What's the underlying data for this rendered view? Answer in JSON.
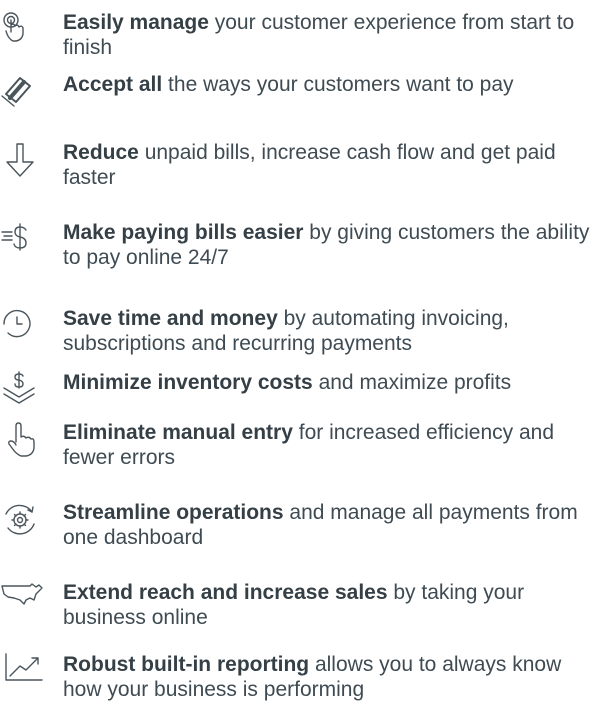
{
  "features": [
    {
      "icon": "touch-hand-icon",
      "lead": "Easily manage",
      "rest": " your customer experience from start to finish"
    },
    {
      "icon": "payment-card-icon",
      "lead": "Accept all",
      "rest": " the ways your customers want to pay"
    },
    {
      "icon": "arrow-down-icon",
      "lead": "Reduce",
      "rest": " unpaid bills, increase cash flow and get paid faster"
    },
    {
      "icon": "bill-dollar-icon",
      "lead": "Make paying bills easier",
      "rest": " by giving customers the ability to pay online 24/7"
    },
    {
      "icon": "clock-icon",
      "lead": "Save time and money",
      "rest": " by automating invoicing, subscriptions and recurring payments"
    },
    {
      "icon": "dollar-chevrons-icon",
      "lead": "Minimize inventory costs",
      "rest": " and maximize profits"
    },
    {
      "icon": "pointer-hand-icon",
      "lead": "Eliminate manual entry",
      "rest": " for increased efficiency and fewer errors"
    },
    {
      "icon": "gear-refresh-icon",
      "lead": "Streamline operations",
      "rest": " and manage all payments from one dashboard"
    },
    {
      "icon": "us-map-icon",
      "lead": "Extend reach and increase sales",
      "rest": " by taking your business online"
    },
    {
      "icon": "trend-chart-icon",
      "lead": "Robust built-in reporting",
      "rest": " allows you to always know how your business is performing"
    }
  ]
}
